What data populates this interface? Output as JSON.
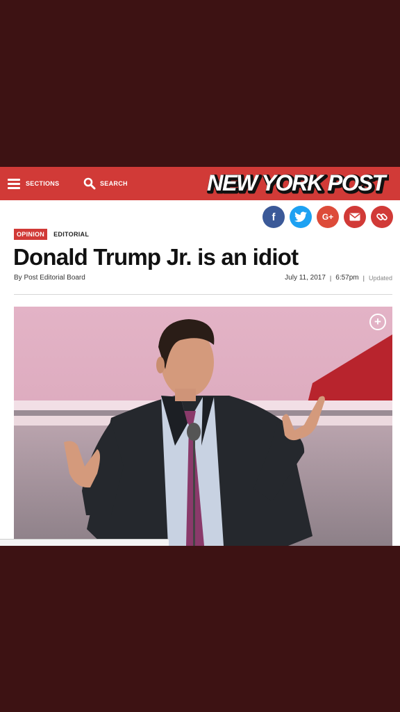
{
  "header": {
    "sections_label": "SECTIONS",
    "search_label": "SEARCH",
    "logo_text": "NEW YORK POST",
    "brand_color": "#d13a37"
  },
  "share": {
    "facebook": "f",
    "google_plus": "G+",
    "icons": [
      "facebook-icon",
      "twitter-icon",
      "google-plus-icon",
      "email-icon",
      "link-icon"
    ]
  },
  "article": {
    "category_badge": "OPINION",
    "section": "EDITORIAL",
    "headline": "Donald Trump Jr. is an idiot",
    "byline": "By Post Editorial Board",
    "date": "July 11, 2017",
    "time": "6:57pm",
    "separator": "|",
    "updated": "Updated"
  },
  "photo": {
    "expand_symbol": "+"
  }
}
